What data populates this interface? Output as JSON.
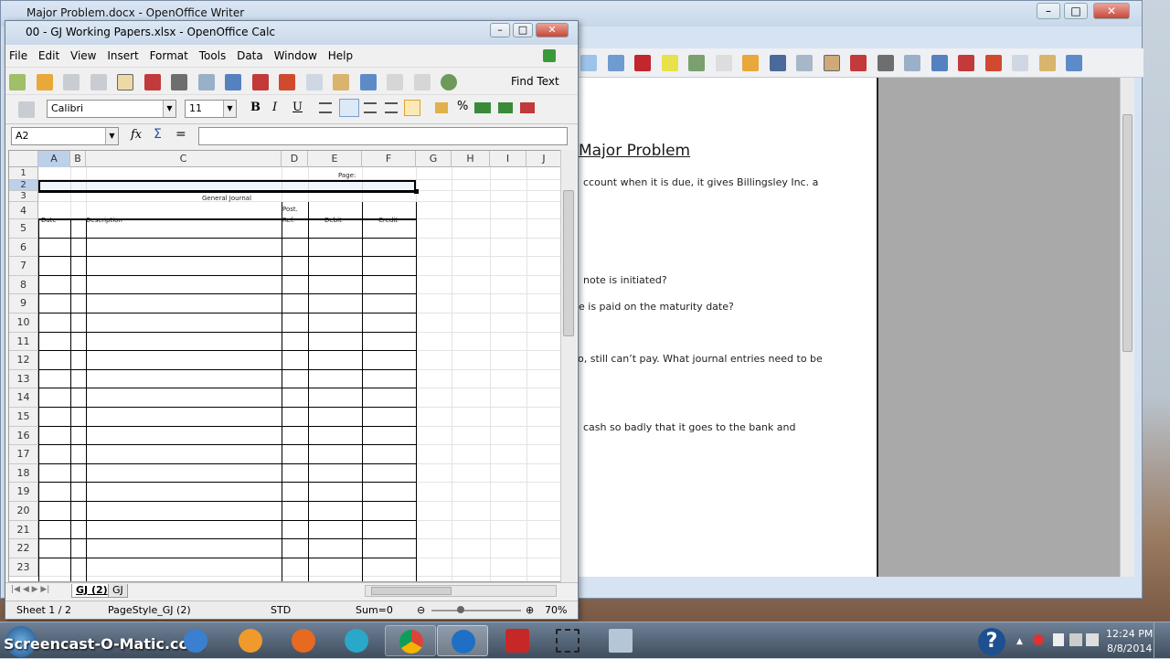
{
  "writer": {
    "title": "Major Problem.docx - OpenOffice Writer",
    "doc_heading": "Major Problem",
    "doc_lines": [
      "ccount when it is due, it gives Billingsley Inc. a",
      "note is initiated?",
      "e is paid on the maturity date?",
      "o, still can’t pay. What journal entries need to be",
      "cash so badly that it goes to the bank and"
    ]
  },
  "calc": {
    "title": "00 - GJ Working Papers.xlsx - OpenOffice Calc",
    "menu": [
      "File",
      "Edit",
      "View",
      "Insert",
      "Format",
      "Tools",
      "Data",
      "Window",
      "Help"
    ],
    "find_text": "Find Text",
    "font_name": "Calibri",
    "font_size": "11",
    "bold": "B",
    "italic": "I",
    "underline": "U",
    "cell_ref": "A2",
    "fx": "fx",
    "sigma": "Σ",
    "equals": "=",
    "columns": [
      "A",
      "B",
      "C",
      "D",
      "E",
      "F",
      "G",
      "H",
      "I",
      "J"
    ],
    "rows": [
      "1",
      "2",
      "3",
      "4",
      "5",
      "6",
      "7",
      "8",
      "9",
      "10",
      "11",
      "12",
      "13",
      "14",
      "15",
      "16",
      "17",
      "18",
      "19",
      "20",
      "21",
      "22",
      "23"
    ],
    "cells": {
      "page": "Page:",
      "general_journal": "General Journal",
      "date": "Date",
      "description": "Description",
      "post": "Post.",
      "ref": "Ref.",
      "debit": "Debit",
      "credit": "Credit"
    },
    "sheet_tabs": [
      "GJ (2)",
      "GJ"
    ],
    "status": {
      "sheet": "Sheet 1 / 2",
      "pagestyle": "PageStyle_GJ (2)",
      "mode": "STD",
      "sum": "Sum=0",
      "zoom": "70%"
    }
  },
  "taskbar": {
    "watermark": "Screencast-O-Matic.com",
    "time": "12:24 PM",
    "date": "8/8/2014"
  },
  "colors": {
    "accent": "#3d7bd9",
    "close": "#c8463a"
  }
}
